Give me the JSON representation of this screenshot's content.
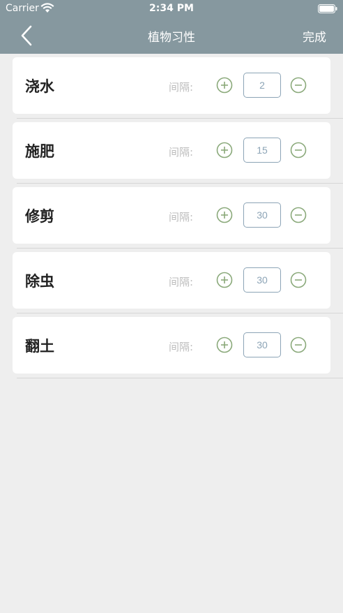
{
  "status_bar": {
    "carrier": "Carrier",
    "time": "2:34 PM"
  },
  "nav": {
    "title": "植物习性",
    "done_label": "完成"
  },
  "interval_label": "间隔:",
  "colors": {
    "header": "#86989f",
    "accent_green": "#8aa97a",
    "box_border": "#8ca4b6"
  },
  "rows": [
    {
      "label": "浇水",
      "value": "2"
    },
    {
      "label": "施肥",
      "value": "15"
    },
    {
      "label": "修剪",
      "value": "30"
    },
    {
      "label": "除虫",
      "value": "30"
    },
    {
      "label": "翻土",
      "value": "30"
    }
  ]
}
